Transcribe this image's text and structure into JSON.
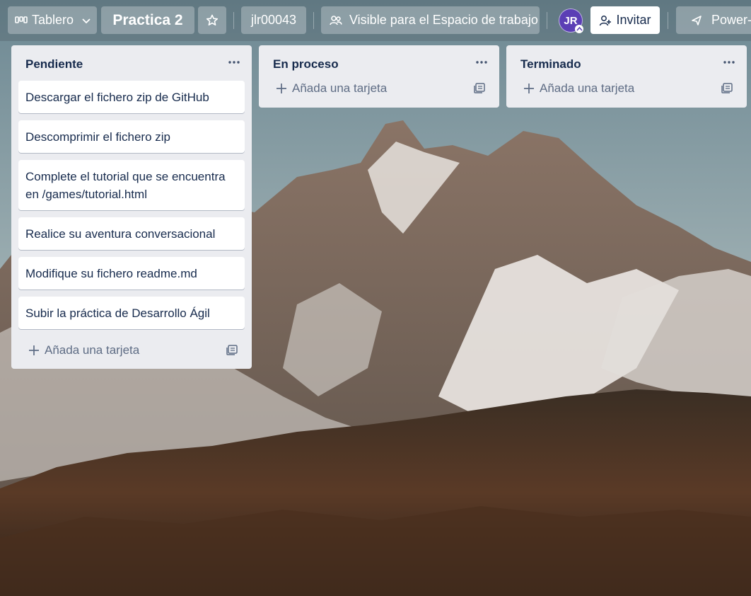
{
  "header": {
    "view_switch": {
      "label": "Tablero",
      "icon": "board-icon"
    },
    "board_title": "Practica 2",
    "star_icon": "star-icon",
    "workspace": "jlr00043",
    "visibility": {
      "label": "Visible para el Espacio de trabajo",
      "icon": "workspace-visible-icon"
    },
    "member_avatar": {
      "initials": "JR",
      "color": "#5b3fb5"
    },
    "invite": {
      "label": "Invitar",
      "icon": "add-member-icon"
    },
    "power_ups": {
      "label": "Power-U",
      "icon": "rocket-icon"
    }
  },
  "lists": [
    {
      "title": "Pendiente",
      "cards": [
        "Descargar el fichero zip de GitHub",
        "Descomprimir el fichero zip",
        "Complete el tutorial que se encuentra en /games/tutorial.html",
        "Realice su aventura conversacional",
        "Modifique su fichero readme.md",
        "Subir la práctica de Desarrollo Ágil"
      ],
      "add_card_label": "Añada una tarjeta"
    },
    {
      "title": "En proceso",
      "cards": [],
      "add_card_label": "Añada una tarjeta"
    },
    {
      "title": "Terminado",
      "cards": [],
      "add_card_label": "Añada una tarjeta"
    }
  ],
  "colors": {
    "list_background": "#ebecf0",
    "card_text": "#172b4d",
    "muted_text": "#5e6c84",
    "avatar": "#5b3fb5"
  }
}
